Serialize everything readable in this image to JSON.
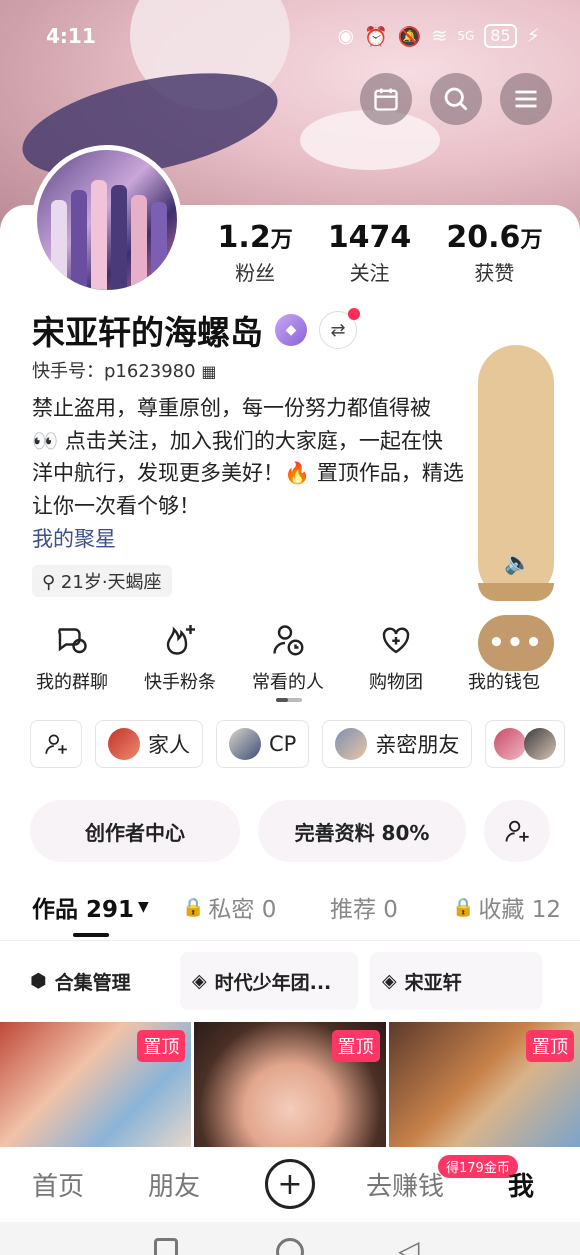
{
  "status_bar": {
    "time": "4:11",
    "signal": "5G",
    "battery": "85"
  },
  "profile": {
    "name": "宋亚轩的海螺岛",
    "kuaishou_id": "快手号：p1623980",
    "stats": [
      {
        "num": "1.2",
        "unit": "万",
        "label": "粉丝"
      },
      {
        "num": "1474",
        "unit": "",
        "label": "关注"
      },
      {
        "num": "20.6",
        "unit": "万",
        "label": "获赞"
      }
    ],
    "bio_lines": [
      "禁止盗用，尊重原创，每一份努力都值得被",
      "👀 点击关注，加入我们的大家庭，一起在快",
      "洋中航行，发现更多美好！🔥 置顶作品，精选",
      "让你一次看个够！"
    ],
    "link_text": "我的聚星",
    "tag": "21岁·天蝎座"
  },
  "shortcuts": [
    {
      "label": "我的群聊",
      "icon": "chat-bubbles-icon"
    },
    {
      "label": "快手粉条",
      "icon": "fire-plus-icon"
    },
    {
      "label": "常看的人",
      "icon": "person-clock-icon"
    },
    {
      "label": "购物团",
      "icon": "heart-plus-icon"
    },
    {
      "label": "我的钱包",
      "icon": "wallet-icon"
    }
  ],
  "chips": [
    "家人",
    "CP",
    "亲密朋友"
  ],
  "pills": {
    "creator": "创作者中心",
    "complete": "完善资料 80%"
  },
  "tabs": {
    "works": "作品 291",
    "private": "私密 0",
    "recommend": "推荐 0",
    "favorites": "收藏 12"
  },
  "collections": {
    "manage": "合集管理",
    "col1": "时代少年团...",
    "col2": "宋亚轩"
  },
  "pin_label": "置顶",
  "nav": {
    "home": "首页",
    "friends": "朋友",
    "earn": "去赚钱",
    "me": "我",
    "coin_badge": "得179金币"
  }
}
